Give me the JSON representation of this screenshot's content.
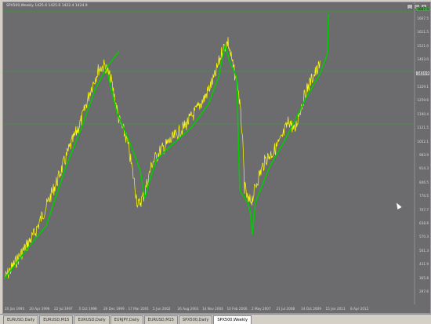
{
  "window": {
    "header": "SPX500,Weekly  1425.6 1425.6 1422.4 1424.9",
    "buttons": [
      "_",
      "□",
      "×"
    ]
  },
  "y_axis": [
    "1667.5",
    "1611.5",
    "1521.0",
    "1463.0",
    "1397.6",
    "1329.1",
    "1259.6",
    "1190.4",
    "1121.5",
    "1052.1",
    "983.9",
    "914.3",
    "846.5",
    "776.5",
    "707.7",
    "638.8",
    "570.3",
    "501.3",
    "431.9",
    "365.8",
    "297.6"
  ],
  "x_axis": [
    "20 Jan 1995",
    "20 Apr 1996",
    "22 Jul 1997",
    "5 Oct 1998",
    "26 Dec 1999",
    "17 Mar 2001",
    "5 Jun 2002",
    "26 Aug 2003",
    "14 Nov 2004",
    "10 Feb 2006",
    "2 May 2007",
    "21 Jul 2008",
    "14 Oct 2009",
    "15 Jan 2011",
    "8 Apr 2012"
  ],
  "price_tags": [
    "1424.9",
    "1667.5"
  ],
  "colors": {
    "background": "#6c6b6e",
    "price": "#ffff00",
    "ma": "#00cc00",
    "level": "#3ea83e"
  },
  "tabs": [
    {
      "label": "EURUSD,Daily",
      "active": false
    },
    {
      "label": "EURUSD,M15",
      "active": false
    },
    {
      "label": "EURUSD,Daily",
      "active": false
    },
    {
      "label": "EURJPY,Daily",
      "active": false
    },
    {
      "label": "EURUSD,M15",
      "active": false
    },
    {
      "label": "SPX500,Daily",
      "active": false
    },
    {
      "label": "SPX500,Weekly",
      "active": true
    }
  ]
}
